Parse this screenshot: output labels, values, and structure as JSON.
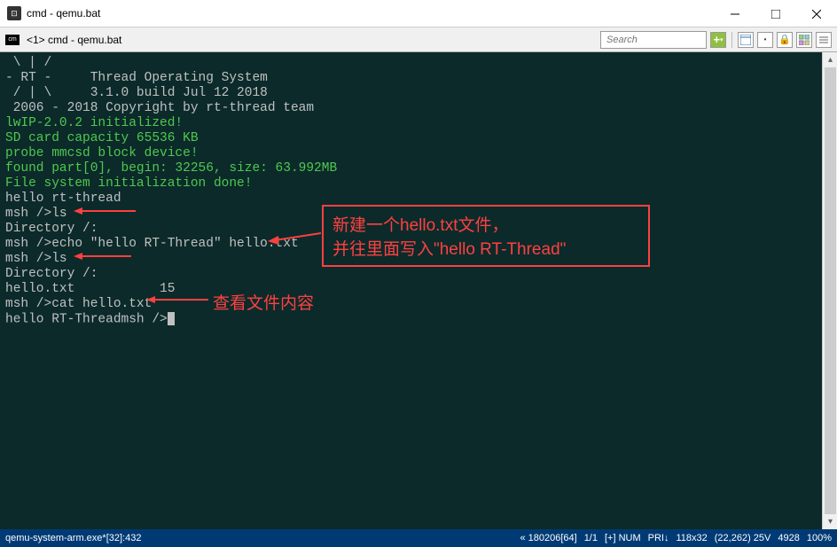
{
  "window": {
    "title": "cmd - qemu.bat"
  },
  "toolbar": {
    "tab_label": "<1> cmd - qemu.bat",
    "search_placeholder": "Search"
  },
  "terminal": {
    "lines": [
      " \\ | /",
      "- RT -     Thread Operating System",
      " / | \\     3.1.0 build Jul 12 2018",
      " 2006 - 2018 Copyright by rt-thread team",
      "lwIP-2.0.2 initialized!",
      "SD card capacity 65536 KB",
      "probe mmcsd block device!",
      "found part[0], begin: 32256, size: 63.992MB",
      "File system initialization done!",
      "hello rt-thread",
      "msh />ls",
      "Directory /:",
      "msh />echo \"hello RT-Thread\" hello.txt",
      "msh />ls",
      "Directory /:",
      "hello.txt           15",
      "msh />cat hello.txt",
      "hello RT-Threadmsh />"
    ],
    "green_lines": [
      4,
      5,
      6,
      7,
      8
    ]
  },
  "annotations": {
    "box1_line1": "新建一个hello.txt文件，",
    "box1_line2": "并往里面写入\"hello RT-Thread\"",
    "label2": "查看文件内容"
  },
  "status": {
    "left": "qemu-system-arm.exe*[32]:432",
    "right_1": "« 180206[64]",
    "right_2": "1/1",
    "right_3": "[+] NUM",
    "right_4": "PRI↓",
    "right_5": "118x32",
    "right_6": "(22,262) 25V",
    "right_7": "4928",
    "right_8": "100%"
  }
}
